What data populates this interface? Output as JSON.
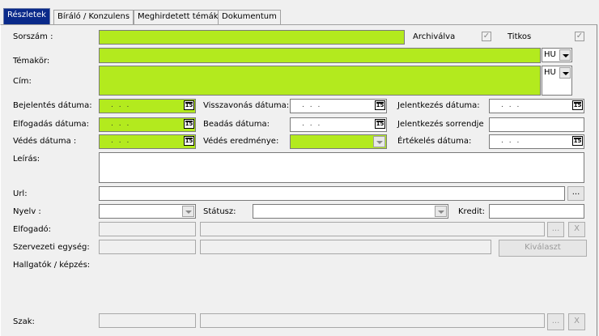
{
  "tabs": [
    "Részletek",
    "Bíráló / Konzulens",
    "Meghirdetett témák",
    "Dokumentum"
  ],
  "labels": {
    "sorszam": "Sorszám :",
    "archivalva": "Archiválva",
    "titkos": "Titkos",
    "temakor": "Témakör:",
    "cim": "Cím:",
    "bejelentes": "Bejelentés dátuma:",
    "elfogadas": "Elfogadás dátuma:",
    "vedes_datuma": "Védés dátuma :",
    "visszavonas": "Visszavonás dátuma:",
    "beadas": "Beadás dátuma:",
    "vedes_eredmenye": "Védés eredménye:",
    "jelentkezes": "Jelentkezés dátuma:",
    "jelentkezes_sorrendje": "Jelentkezés sorrendje",
    "ertekeles": "Értékelés dátuma:",
    "leiras": "Leírás:",
    "url": "Url:",
    "nyelv": "Nyelv :",
    "statusz": "Státusz:",
    "kredit": "Kredit:",
    "elfogado": "Elfogadó:",
    "szervezeti": "Szervezeti egység:",
    "hallgatok": "Hallgatók / képzés:",
    "szak": "Szak:"
  },
  "language_value": "HU",
  "date_placeholder": ". . .",
  "calendar_icon_text": "15",
  "buttons": {
    "ellipsis": "...",
    "clear": "X",
    "kivalaszt": "Kiválaszt"
  },
  "checkboxes": {
    "archivalva": true,
    "titkos": true
  },
  "colors": {
    "required": "#b3ea1e",
    "active_tab": "#0a2a8a"
  }
}
